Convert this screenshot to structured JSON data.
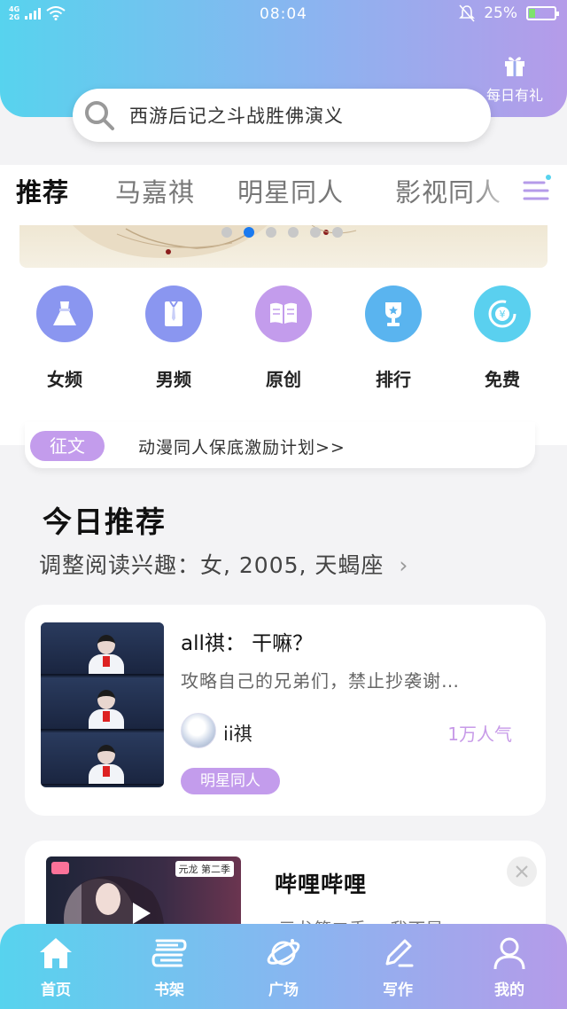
{
  "status_bar": {
    "network_top": "4G",
    "network_bottom": "2G",
    "time": "08:04",
    "battery": "25%",
    "battery_level": 0.25,
    "icons": [
      "signal-icon",
      "wifi-icon",
      "bell-muted-icon",
      "battery-icon"
    ]
  },
  "header": {
    "gift_label": "每日有礼",
    "gift_icon": "gift-icon"
  },
  "search": {
    "placeholder": "西游后记之斗战胜佛演义",
    "icon": "search-icon"
  },
  "tabs": [
    {
      "label": "推荐",
      "active": true
    },
    {
      "label": "马嘉祺",
      "active": false
    },
    {
      "label": "明星同人",
      "active": false
    },
    {
      "label": "影视同人",
      "active": false
    }
  ],
  "carousel": {
    "count": 6,
    "active_index": 1
  },
  "categories": [
    {
      "label": "女频",
      "icon": "dress-icon",
      "color": "#8a96f0"
    },
    {
      "label": "男频",
      "icon": "shirt-icon",
      "color": "#8a96f0"
    },
    {
      "label": "原创",
      "icon": "book-icon",
      "color": "#c39cec"
    },
    {
      "label": "排行",
      "icon": "trophy-icon",
      "color": "#5ab4ef"
    },
    {
      "label": "免费",
      "icon": "yuan-coin-icon",
      "color": "#5ad0ef"
    }
  ],
  "notice": {
    "tag": "征文",
    "text": "动漫同人保底激励计划>>"
  },
  "recommend": {
    "title": "今日推荐",
    "subtitle": "调整阅读兴趣：女, 2005, 天蝎座",
    "subtitle_chevron": "›"
  },
  "books": [
    {
      "title": "all祺： 干嘛？",
      "description": "攻略自己的兄弟们，禁止抄袭谢…",
      "author": "ii祺",
      "popularity": "1万人气",
      "tag": "明星同人"
    },
    {
      "title": "哔哩哔哩",
      "cover_tag": "元龙 第二季",
      "description": "元龙第二季 …我不是"
    }
  ],
  "bottom_nav": [
    {
      "label": "首页",
      "icon": "home-icon",
      "active": true
    },
    {
      "label": "书架",
      "icon": "bookshelf-icon",
      "active": false
    },
    {
      "label": "广场",
      "icon": "planet-icon",
      "active": false
    },
    {
      "label": "写作",
      "icon": "pen-icon",
      "active": false
    },
    {
      "label": "我的",
      "icon": "user-icon",
      "active": false
    }
  ],
  "colors": {
    "gradient_start": "#57d3ee",
    "gradient_mid": "#8bb4f0",
    "gradient_end": "#b59be9",
    "accent_purple": "#c39cec",
    "carousel_active": "#1a7af0"
  }
}
